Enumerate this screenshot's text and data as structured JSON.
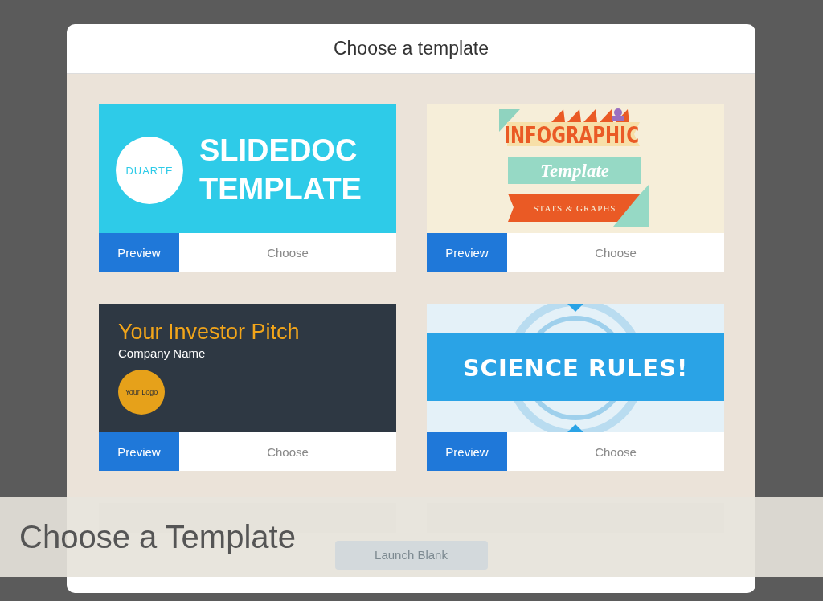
{
  "dialog": {
    "title": "Choose a template",
    "templates": [
      {
        "kind": "slidedoc",
        "logo": "DUARTE",
        "title_lines": [
          "SLIDEDOC",
          "TEMPLATE"
        ],
        "preview": "Preview",
        "choose": "Choose"
      },
      {
        "kind": "infographic",
        "headline": "INFOGRAPHIC",
        "subtitle": "Template",
        "tagline": "STATS & GRAPHS",
        "preview": "Preview",
        "choose": "Choose"
      },
      {
        "kind": "pitch",
        "headline": "Your Investor Pitch",
        "company": "Company Name",
        "logo": "Your Logo",
        "preview": "Preview",
        "choose": "Choose"
      },
      {
        "kind": "science",
        "headline": "SCIENCE RULES!",
        "preview": "Preview",
        "choose": "Choose"
      },
      {
        "kind": "blank"
      },
      {
        "kind": "blank"
      }
    ],
    "launch_button": {
      "label": "Launch Blank",
      "disabled": true
    }
  },
  "caption": "Choose a Template"
}
